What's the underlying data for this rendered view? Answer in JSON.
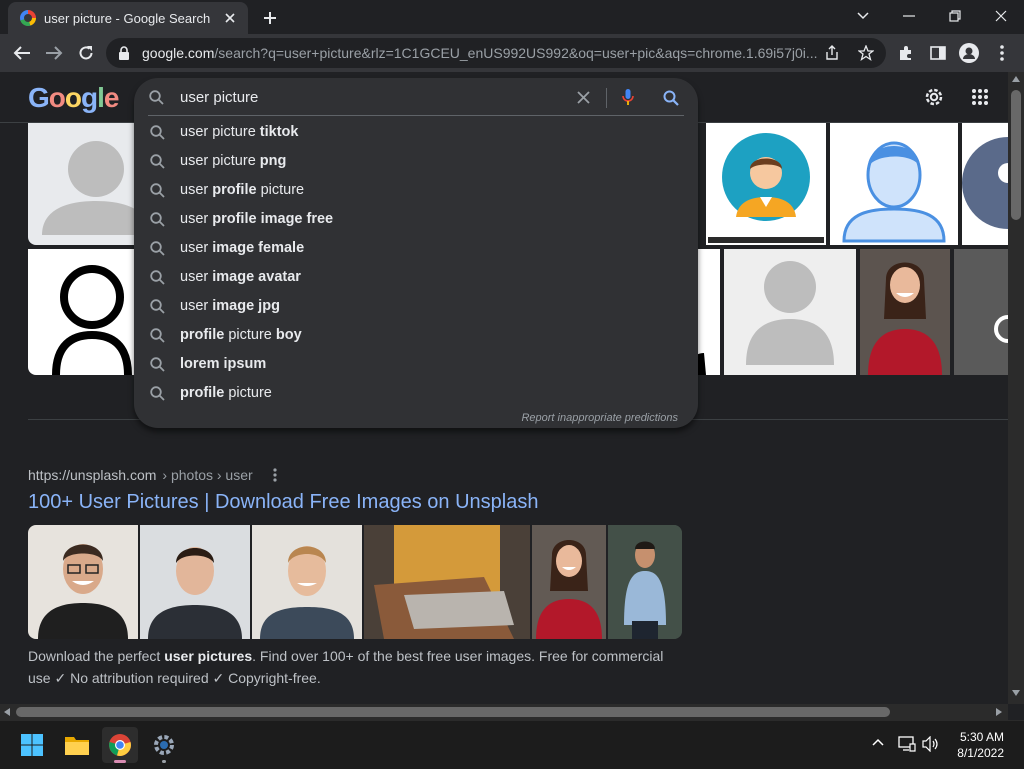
{
  "browser": {
    "tab_title": "user picture - Google Search",
    "url_host": "google.com",
    "url_rest": "/search?q=user+picture&rlz=1C1GCEU_enUS992US992&oq=user+pic&aqs=chrome.1.69i57j0i..."
  },
  "google": {
    "logo_letters": [
      "G",
      "o",
      "o",
      "g",
      "l",
      "e"
    ],
    "logo_colors": [
      "#8ab4f8",
      "#f28b82",
      "#fdd663",
      "#8ab4f8",
      "#81c995",
      "#f28b82"
    ]
  },
  "search": {
    "query": "user picture",
    "suggestions": [
      {
        "plain": "user picture ",
        "bold": "tiktok",
        "bold_first": false
      },
      {
        "plain": "user picture ",
        "bold": "png",
        "bold_first": false
      },
      {
        "plain": "user ",
        "bold": "profile",
        "rest": " picture",
        "bold_first": false
      },
      {
        "plain": "user ",
        "bold": "profile image free",
        "bold_first": false
      },
      {
        "plain": "user ",
        "bold": "image female",
        "bold_first": false
      },
      {
        "plain": "user ",
        "bold": "image avatar",
        "bold_first": false
      },
      {
        "plain": "user ",
        "bold": "image jpg",
        "bold_first": false
      },
      {
        "bold": "profile",
        "plain": " picture ",
        "bold2": "boy",
        "bold_first": true
      },
      {
        "bold": "lorem ipsum",
        "plain": "",
        "bold_first": true
      },
      {
        "bold": "profile",
        "plain": " picture",
        "bold_first": true
      }
    ],
    "report_text": "Report inappropriate predictions"
  },
  "result": {
    "cite_host": "https://unsplash.com",
    "cite_path": " › photos › user",
    "title": "100+ User Pictures | Download Free Images on Unsplash",
    "snippet_pre": "Download the perfect ",
    "snippet_bold": "user pictures",
    "snippet_post": ". Find over 100+ of the best free user images. Free for commercial use ✓ No attribution required ✓ Copyright-free."
  },
  "taskbar": {
    "time": "5:30 AM",
    "date": "8/1/2022"
  },
  "colors": {
    "bg": "#202124",
    "link": "#8ab4f8",
    "dropdown": "#303134"
  }
}
